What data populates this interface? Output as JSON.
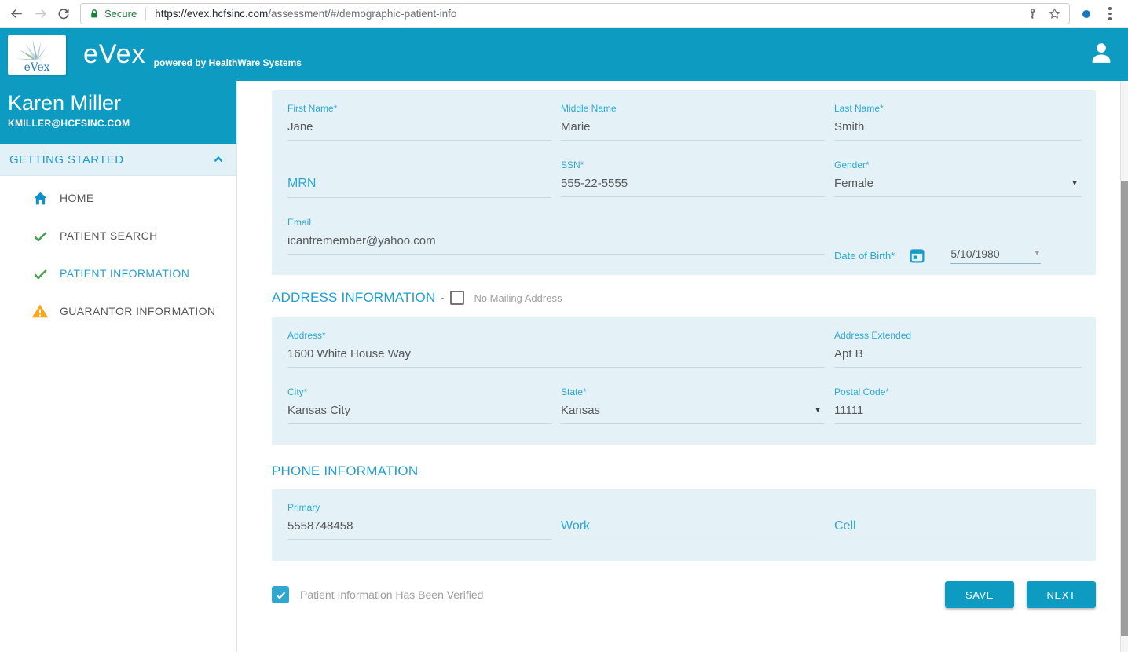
{
  "browser": {
    "secure_label": "Secure",
    "url_origin": "https://evex.hcfsinc.com",
    "url_path": "/assessment/#/demographic-patient-info"
  },
  "header": {
    "logo_word": "eVex",
    "app_name": "eVex",
    "tagline": "powered by HealthWare Systems"
  },
  "sidebar": {
    "user_name": "Karen Miller",
    "user_email": "KMILLER@HCFSINC.COM",
    "section_label": "GETTING STARTED",
    "items": [
      {
        "label": "HOME",
        "icon": "home-icon",
        "status": "current-section"
      },
      {
        "label": "PATIENT SEARCH",
        "icon": "check-icon",
        "status": "complete"
      },
      {
        "label": "PATIENT INFORMATION",
        "icon": "check-icon",
        "status": "complete-active"
      },
      {
        "label": "GUARANTOR INFORMATION",
        "icon": "warning-icon",
        "status": "incomplete"
      }
    ]
  },
  "demographics": {
    "first_name_label": "First Name*",
    "first_name": "Jane",
    "middle_name_label": "Middle Name",
    "middle_name": "Marie",
    "last_name_label": "Last Name*",
    "last_name": "Smith",
    "mrn_label": "MRN",
    "mrn": "",
    "ssn_label": "SSN*",
    "ssn": "555-22-5555",
    "gender_label": "Gender*",
    "gender": "Female",
    "email_label": "Email",
    "email": "icantremember@yahoo.com",
    "dob_label": "Date of Birth*",
    "dob": "5/10/1980"
  },
  "address": {
    "section_title": "ADDRESS INFORMATION",
    "dash": "-",
    "no_mailing_label": "No Mailing Address",
    "no_mailing_checked": false,
    "address_label": "Address*",
    "address": "1600 White House Way",
    "address_ext_label": "Address Extended",
    "address_ext": "Apt B",
    "city_label": "City*",
    "city": "Kansas City",
    "state_label": "State*",
    "state": "Kansas",
    "postal_label": "Postal Code*",
    "postal": "11111"
  },
  "phone": {
    "section_title": "PHONE INFORMATION",
    "primary_label": "Primary",
    "primary": "5558748458",
    "work_label": "Work",
    "work": "",
    "cell_label": "Cell",
    "cell": ""
  },
  "footer": {
    "verified_label": "Patient Information Has Been Verified",
    "verified_checked": true,
    "save": "SAVE",
    "next": "NEXT"
  },
  "colors": {
    "accent_teal": "#0d9bc1",
    "panel_blue": "#e4f2f8",
    "label_blue": "#2fa8d0",
    "secure_green": "#188038",
    "check_green": "#43a047",
    "warning_orange": "#f7a81b"
  }
}
